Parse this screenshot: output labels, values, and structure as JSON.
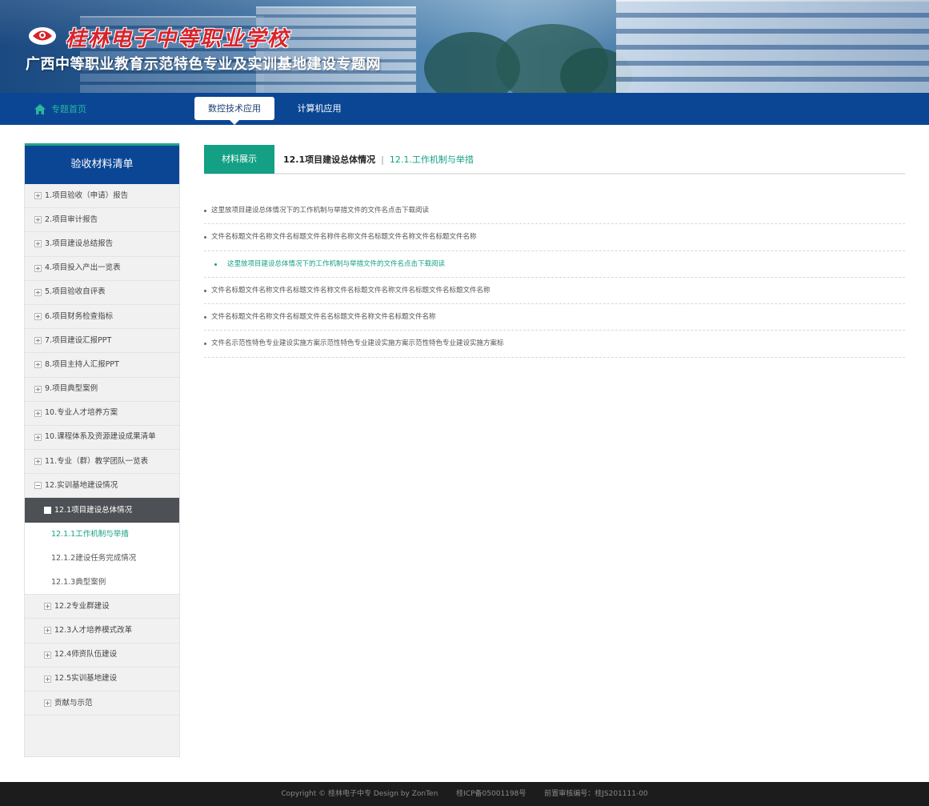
{
  "header": {
    "school_name": "桂林电子中等职业学校",
    "site_title": "广西中等职业教育示范特色专业及实训基地建设专题网"
  },
  "nav": {
    "home_label": "专题首页",
    "tabs": [
      {
        "label": "数控技术应用",
        "active": true
      },
      {
        "label": "计算机应用",
        "active": false
      }
    ]
  },
  "sidebar": {
    "title": "验收材料清单",
    "items": [
      {
        "label": "1.项目验收（申请）报告"
      },
      {
        "label": "2.项目审计报告"
      },
      {
        "label": "3.项目建设总结报告"
      },
      {
        "label": "4.项目投入产出一览表"
      },
      {
        "label": "5.项目验收自评表"
      },
      {
        "label": "6.项目财务检查指标"
      },
      {
        "label": "7.项目建设汇报PPT"
      },
      {
        "label": "8.项目主持人汇报PPT"
      },
      {
        "label": "9.项目典型案例"
      },
      {
        "label": "10.专业人才培养方案"
      },
      {
        "label": "10.课程体系及资源建设成果清单"
      },
      {
        "label": "11.专业（群）教学团队一览表"
      },
      {
        "label": "12.实训基地建设情况"
      }
    ],
    "active_sub": "12.1项目建设总体情况",
    "leaves": [
      {
        "label": "12.1.1工作机制与举措"
      },
      {
        "label": "12.1.2建设任务完成情况"
      },
      {
        "label": "12.1.3典型案例"
      }
    ],
    "subs": [
      {
        "label": "12.2专业群建设"
      },
      {
        "label": "12.3人才培养模式改革"
      },
      {
        "label": "12.4师资队伍建设"
      },
      {
        "label": "12.5实训基地建设"
      },
      {
        "label": "贡献与示范"
      }
    ]
  },
  "main": {
    "tab_label": "材料展示",
    "crumb_parent": "12.1项目建设总体情况",
    "crumb_sep": "|",
    "crumb_current": "12.1.工作机制与举措",
    "files": [
      {
        "text": "这里放项目建设总体情况下的工作机制与举措文件的文件名点击下载阅读"
      },
      {
        "text": "文件名标题文件名称文件名标题文件名称件名称文件名标题文件名称文件名标题文件名称"
      },
      {
        "text": "这里放项目建设总体情况下的工作机制与举措文件的文件名点击下载阅读"
      },
      {
        "text": "文件名标题文件名称文件名标题文件名称文件名标题文件名称文件名标题文件名标题文件名称"
      },
      {
        "text": "文件名标题文件名称文件名标题文件名名标题文件名称文件名标题文件名称"
      },
      {
        "text": "文件名示范性特色专业建设实施方案示范性特色专业建设实施方案示范性特色专业建设实施方案标"
      }
    ]
  },
  "footer": {
    "copyright": "Copyright © 桂林电子中专  Design by ZonTen",
    "icp": "桂ICP备05001198号",
    "review": "前置审核编号：桂JS201111-00"
  }
}
